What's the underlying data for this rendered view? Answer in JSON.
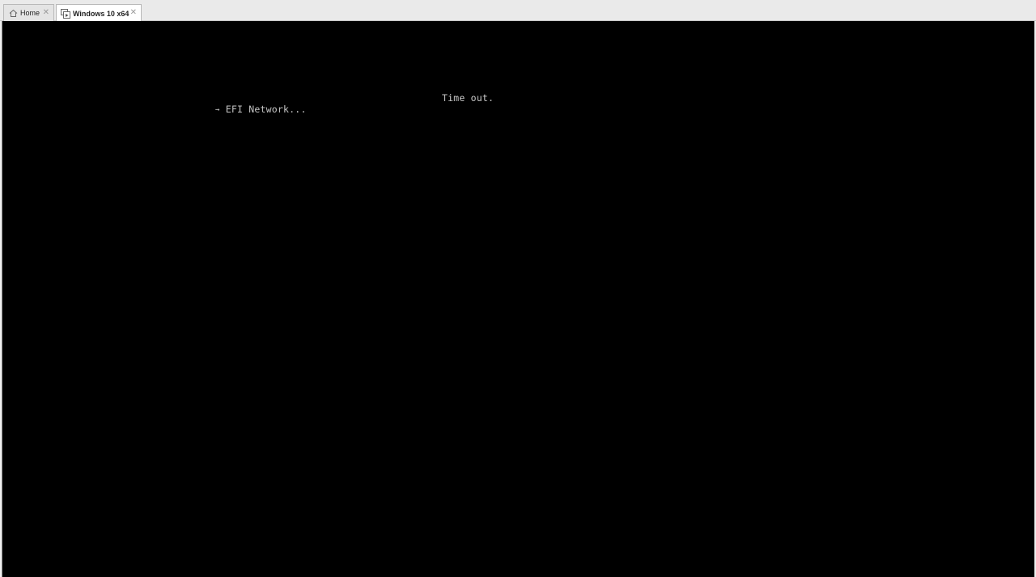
{
  "tabs": [
    {
      "label": "Home",
      "icon": "home-icon",
      "active": false
    },
    {
      "label": "Windows 10 x64",
      "icon": "vm-icon",
      "active": true
    }
  ],
  "close_glyph": "✕",
  "console": {
    "background": "#000000",
    "text_color": "#c6c6c6",
    "timeout_message": "Time out.",
    "boot_entry": {
      "arrow": "→",
      "label": "EFI Network..."
    }
  }
}
